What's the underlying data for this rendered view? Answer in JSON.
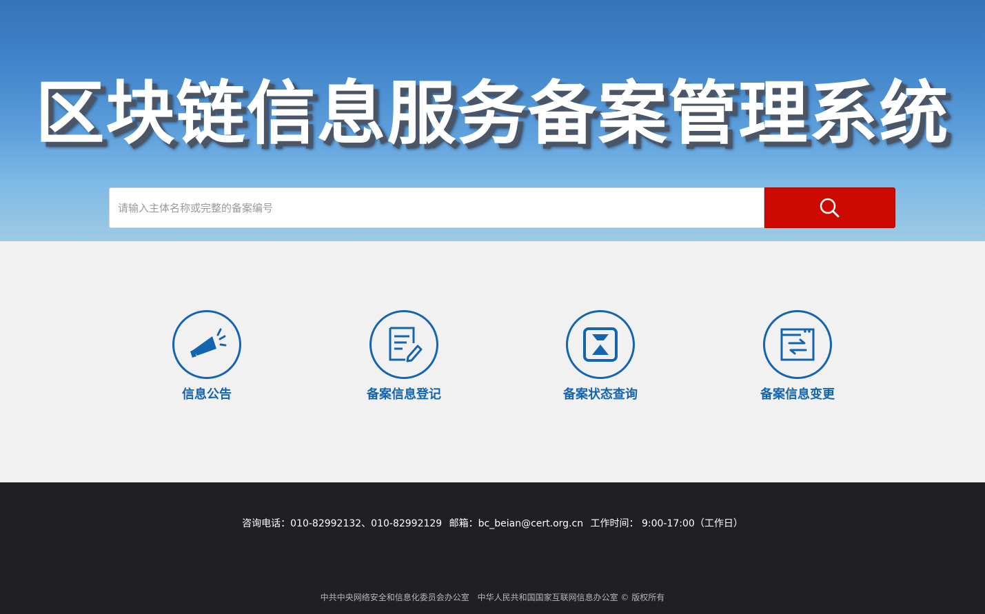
{
  "header": {
    "title": "区块链信息服务备案管理系统"
  },
  "search": {
    "placeholder": "请输入主体名称或完整的备案编号",
    "button_icon": "search-icon",
    "button_color": "#cc0a02"
  },
  "features": [
    {
      "label": "信息公告",
      "icon": "megaphone-icon"
    },
    {
      "label": "备案信息登记",
      "icon": "form-edit-icon"
    },
    {
      "label": "备案状态查询",
      "icon": "hourglass-icon"
    },
    {
      "label": "备案信息变更",
      "icon": "exchange-icon"
    }
  ],
  "footer": {
    "phone": "咨询电话：010-82992132、010-82992129",
    "email": "邮箱：bc_beian@cert.org.cn",
    "hours": "工作时间： 9:00-17:00（工作日）",
    "org1": "中共中央网络安全和信息化委员会办公室",
    "org2": "中华人民共和国国家互联网信息办公室 © 版权所有"
  },
  "colors": {
    "accent": "#1464b0",
    "footer_bg": "#202024",
    "page_bg": "#f1f1f1"
  }
}
